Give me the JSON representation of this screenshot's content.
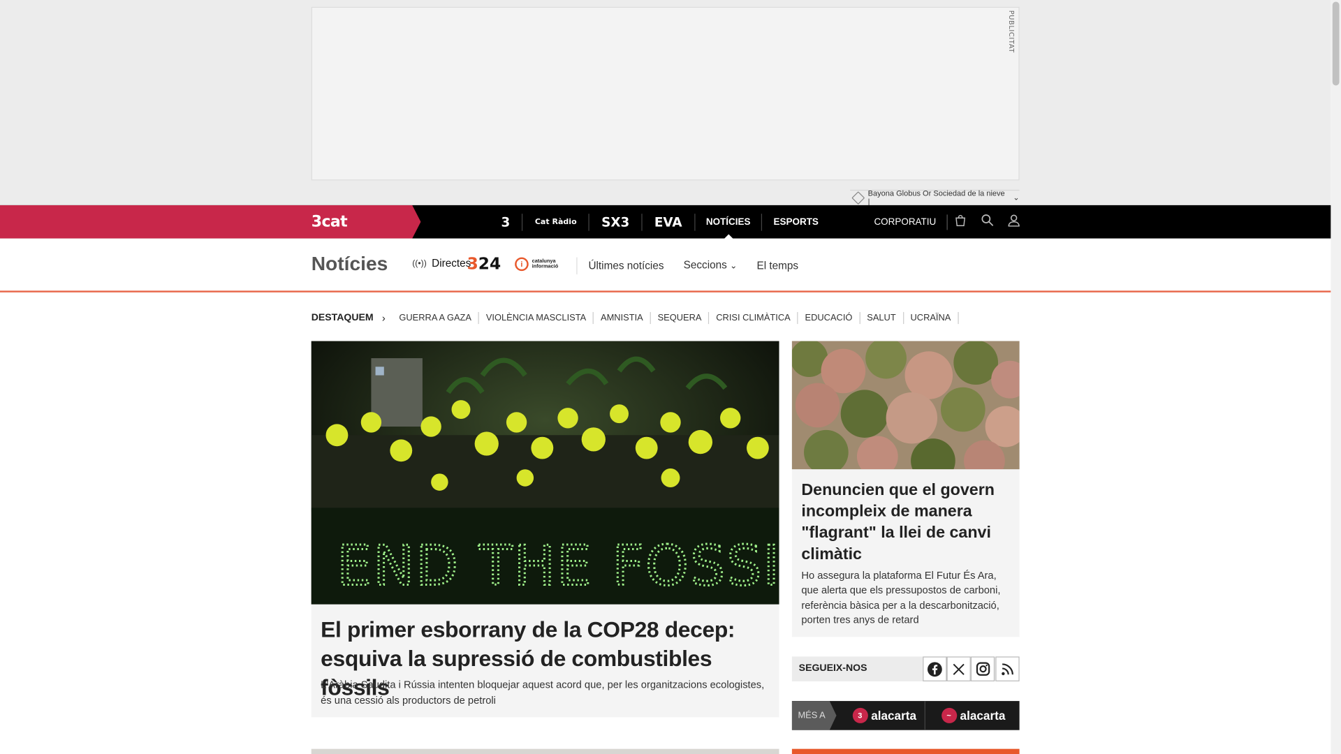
{
  "ad": {
    "label": "PUBLICITAT",
    "info_text": "Bayona Globus Or Sociedad de la nieve |"
  },
  "topnav": {
    "brand": "3cat",
    "channels": [
      "3",
      "Cat Ràdio",
      "SX3",
      "EVA"
    ],
    "links": [
      "NOTÍCIES",
      "ESPORTS"
    ],
    "corporate": "CORPORATIU"
  },
  "section": {
    "title": "Notícies",
    "live_label": "Directes",
    "logo_324": "324",
    "logo_catinfo": "catalunya informació",
    "subnav": [
      "Últimes notícies",
      "Seccions",
      "El temps"
    ]
  },
  "highlights": {
    "label": "DESTAQUEM",
    "tags": [
      "GUERRA A GAZA",
      "VIOLÈNCIA MASCLISTA",
      "AMNISTIA",
      "SEQUERA",
      "CRISI CLIMÀTICA",
      "EDUCACIÓ",
      "SALUT",
      "UCRAÏNA"
    ]
  },
  "main_article": {
    "image_banner_text": "END THE FOSSIL ERA",
    "title": "El primer esborrany de la COP28 decep: esquiva la supressió de combustibles fòssils",
    "summary": "L'Aràbia Saudita i Rússia intenten bloquejar aquest acord que, per les organitzacions ecologistes, és una cessió als productors de petroli"
  },
  "side_article": {
    "title": "Denuncien que el govern incompleix de manera \"flagrant\" la llei de canvi climàtic",
    "summary": "Ho assegura la plataforma El Futur És Ara, que alerta que els pressupostos de carboni, referència bàsica per a la descarbonització, porten tres anys de retard"
  },
  "follow": {
    "label": "SEGUEIX-NOS",
    "networks": [
      "facebook-icon",
      "x-icon",
      "instagram-icon",
      "rss-icon"
    ]
  },
  "alacarta": {
    "more_label": "MÉS A",
    "items": [
      "alacarta",
      "alacarta"
    ]
  },
  "colors": {
    "brand_red": "#c8274a",
    "accent_orange": "#e8582b",
    "nav_black": "#000000"
  }
}
